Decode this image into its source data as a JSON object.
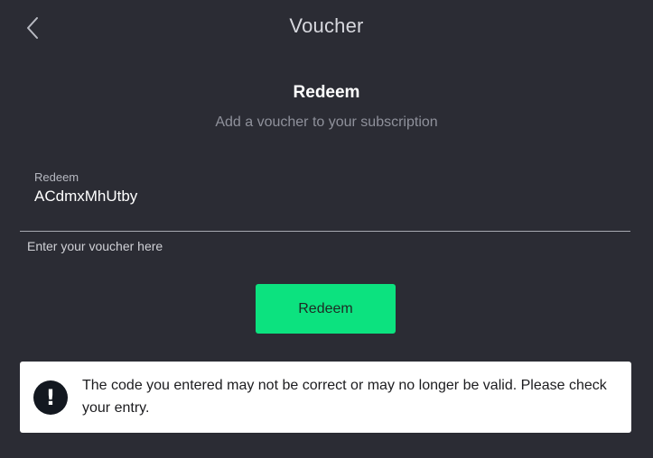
{
  "header": {
    "back_icon": "chevron-left-icon",
    "title": "Voucher"
  },
  "section": {
    "title": "Redeem",
    "subtitle": "Add a voucher to your subscription"
  },
  "voucher_field": {
    "label": "Redeem",
    "value": "ACdmxMhUtby",
    "helper": "Enter your voucher here"
  },
  "redeem_button": {
    "label": "Redeem",
    "color": "#0ce27f"
  },
  "alert": {
    "icon": "exclamation-icon",
    "message": "The code you entered may not be correct or may no longer be valid. Please check your entry."
  },
  "colors": {
    "background": "#2b2c34",
    "accent": "#0ce27f",
    "alert_background": "#ffffff"
  }
}
